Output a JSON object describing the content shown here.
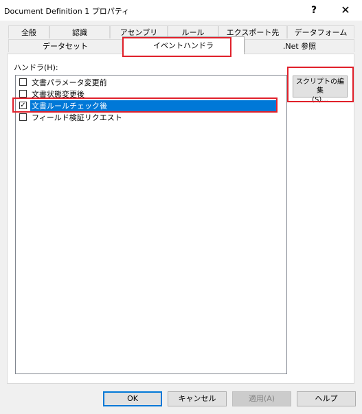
{
  "window": {
    "title": "Document Definition 1 プロパティ",
    "help_glyph": "?",
    "close_glyph": "✕"
  },
  "tabs": {
    "row1": [
      "全般",
      "認識",
      "アセンブリ",
      "ルール",
      "エクスポート先",
      "データフォーム"
    ],
    "row2": [
      "データセット",
      "イベントハンドラ",
      ".Net 参照"
    ]
  },
  "handlers": {
    "label": "ハンドラ(H):",
    "items": [
      {
        "label": "文書パラメータ変更前",
        "checked": false
      },
      {
        "label": "文書状態変更後",
        "checked": false
      },
      {
        "label": "文書ルールチェック後",
        "checked": true
      },
      {
        "label": "フィールド検証リクエスト",
        "checked": false
      }
    ],
    "checkmark": "✓"
  },
  "script_button": {
    "line1": "スクリプトの編集",
    "line2": "(S)..."
  },
  "buttons": {
    "ok": "OK",
    "cancel": "キャンセル",
    "apply": "適用(A)",
    "help": "ヘルプ"
  },
  "colors": {
    "highlight_box": "#e0202a",
    "selection": "#0078d7"
  }
}
